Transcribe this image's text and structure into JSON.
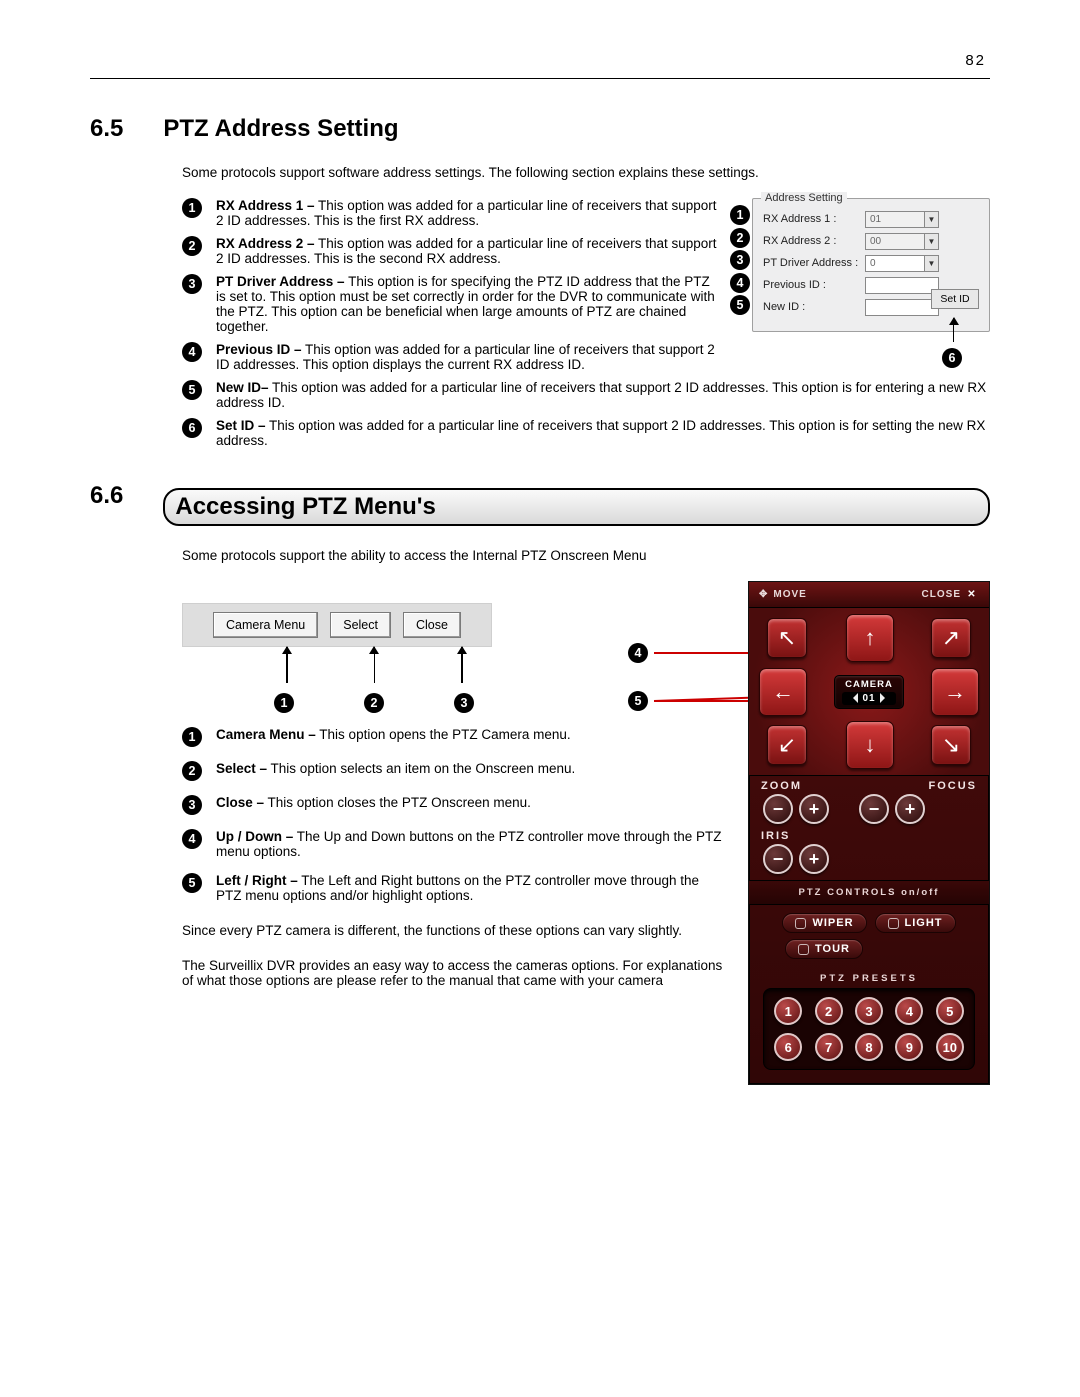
{
  "page_number": "82",
  "section65": {
    "num": "6.5",
    "title": "PTZ Address Setting",
    "intro": "Some protocols support software address settings.  The following section explains these settings.",
    "items": [
      {
        "n": "1",
        "term": "RX Address 1 –",
        "body": " This option was added for a particular line of receivers that support 2 ID addresses. This is the first RX address."
      },
      {
        "n": "2",
        "term": "RX Address 2 –",
        "body": " This option was added for a particular line of receivers that support 2 ID addresses. This is the second RX address."
      },
      {
        "n": "3",
        "term": "PT Driver Address –",
        "body": " This option is for specifying the PTZ ID address that the PTZ is set to. This option must be set correctly in order for the DVR to communicate with the PTZ. This option can be beneficial when large amounts of PTZ are chained together."
      },
      {
        "n": "4",
        "term": "Previous ID –",
        "body": " This option was added for a particular line of receivers that support 2 ID addresses. This option displays the current RX address ID."
      },
      {
        "n": "5",
        "term": "New ID–",
        "body": " This option was added for a particular line of receivers that support 2 ID addresses. This option is for entering a new RX address ID."
      },
      {
        "n": "6",
        "term": "Set ID –",
        "body": " This option was added for a particular line of receivers that support 2 ID addresses. This option is for setting the new RX address."
      }
    ]
  },
  "addr_panel": {
    "box_title": "Address Setting",
    "rx1": "RX Address 1 :",
    "rx2": "RX Address 2 :",
    "pt": "PT Driver Address  :",
    "prev": "Previous ID :",
    "newid": "New ID :",
    "rx1v": "01",
    "rx2v": "00",
    "ptv": "0",
    "set_btn": "Set ID",
    "bullets": [
      "1",
      "2",
      "3",
      "4",
      "5"
    ],
    "bullet6": "6"
  },
  "section66": {
    "num": "6.6",
    "title": "Accessing PTZ Menu's",
    "intro": "Some protocols support the ability to access the Internal PTZ Onscreen Menu",
    "btns": {
      "menu": "Camera Menu",
      "select": "Select",
      "close": "Close"
    },
    "btns_bullets": [
      "1",
      "2",
      "3"
    ],
    "items": [
      {
        "n": "1",
        "term": "Camera Menu –",
        "body": " This option opens the PTZ Camera menu."
      },
      {
        "n": "2",
        "term": "Select –",
        "body": " This option selects an item on the Onscreen menu."
      },
      {
        "n": "3",
        "term": "Close –",
        "body": " This option closes the PTZ Onscreen menu."
      },
      {
        "n": "4",
        "term": "Up / Down –",
        "body": " The Up and Down buttons on the PTZ controller move through the PTZ menu options."
      },
      {
        "n": "5",
        "term": "Left / Right –",
        "body": " The Left and Right buttons on the PTZ controller move through the PTZ menu options and/or highlight options."
      }
    ],
    "p1": "Since every PTZ camera is different, the functions of these options can vary slightly.",
    "p2": "The Surveillix DVR provides an easy way to access the cameras options. For explanations of what those options are please refer to the manual that came with your camera",
    "ptr4": "4",
    "ptr5": "5"
  },
  "ptz": {
    "move": "MOVE",
    "close": "CLOSE",
    "camera": "CAMERA",
    "cam_num": "01",
    "zoom": "ZOOM",
    "focus": "FOCUS",
    "iris": "IRIS",
    "onoff": "PTZ CONTROLS  on/off",
    "wiper": "WIPER",
    "light": "LIGHT",
    "tour": "TOUR",
    "presets_lbl": "PTZ PRESETS",
    "presets": [
      "1",
      "2",
      "3",
      "4",
      "5",
      "6",
      "7",
      "8",
      "9",
      "10"
    ]
  }
}
